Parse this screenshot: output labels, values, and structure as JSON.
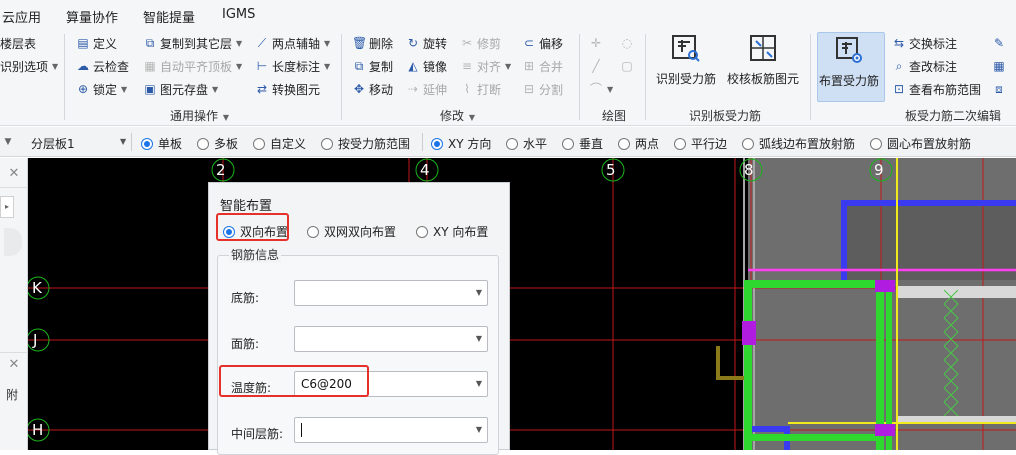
{
  "menubar": {
    "items": [
      "云应用",
      "算量协作",
      "智能提量",
      "IGMS"
    ]
  },
  "ribbon": {
    "left_cut": {
      "item1": "楼层表",
      "item2": "识别选项"
    },
    "general_ops": {
      "label": "通用操作",
      "define": "定义",
      "copy_to_floor": "复制到其它层",
      "two_point_axis": "两点辅轴",
      "cloud_check": "云检查",
      "auto_flat_top": "自动平齐顶板",
      "length_mark": "长度标注",
      "lock": "锁定",
      "element_save": "图元存盘",
      "convert_element": "转换图元"
    },
    "modify": {
      "label": "修改",
      "delete": "删除",
      "rotate": "旋转",
      "trim": "修剪",
      "offset": "偏移",
      "copy": "复制",
      "mirror": "镜像",
      "align": "对齐",
      "merge": "合并",
      "move": "移动",
      "extend": "延伸",
      "break": "打断",
      "split": "分割"
    },
    "draw": {
      "label": "绘图"
    },
    "identify": {
      "label": "识别板受力筋",
      "identify_rebar": "识别受力筋",
      "check_rebar": "校核板筋图元"
    },
    "secondary": {
      "label": "板受力筋二次编辑",
      "place_rebar": "布置受力筋",
      "swap_mark": "交换标注",
      "check_mark": "查改标注",
      "view_range": "查看布筋范围"
    }
  },
  "optionbar": {
    "floor_select": "分层板1",
    "radios1": [
      {
        "label": "单板",
        "checked": true
      },
      {
        "label": "多板",
        "checked": false
      },
      {
        "label": "自定义",
        "checked": false
      },
      {
        "label": "按受力筋范围",
        "checked": false
      }
    ],
    "radios2": [
      {
        "label": "XY 方向",
        "checked": true
      },
      {
        "label": "水平",
        "checked": false
      },
      {
        "label": "垂直",
        "checked": false
      },
      {
        "label": "两点",
        "checked": false
      },
      {
        "label": "平行边",
        "checked": false
      },
      {
        "label": "弧线边布置放射筋",
        "checked": false
      },
      {
        "label": "圆心布置放射筋",
        "checked": false
      }
    ]
  },
  "leftpanel": {
    "tab_text": "附"
  },
  "canvas": {
    "axis_top": [
      "2",
      "4",
      "5",
      "8",
      "9"
    ],
    "axis_left": [
      "K",
      "J",
      "H"
    ]
  },
  "dialog": {
    "title": "智能布置",
    "modes": [
      {
        "label": "双向布置",
        "checked": true
      },
      {
        "label": "双网双向布置",
        "checked": false
      },
      {
        "label": "XY 向布置",
        "checked": false
      }
    ],
    "section_title": "钢筋信息",
    "bottom_label": "底筋:",
    "bottom_value": "",
    "top_label": "面筋:",
    "top_value": "",
    "temp_label": "温度筋:",
    "temp_value": "C6@200",
    "mid_label": "中间层筋:",
    "mid_value": ""
  }
}
